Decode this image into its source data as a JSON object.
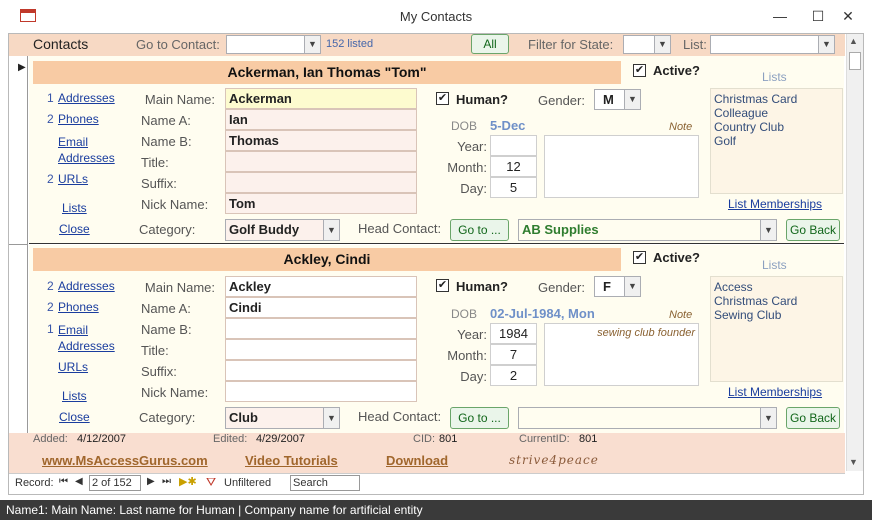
{
  "window": {
    "title": "My Contacts",
    "minimize": "—",
    "maximize": "☐",
    "close": "✕"
  },
  "header": {
    "title": "Contacts",
    "goto_label": "Go to Contact:",
    "listed": "152 listed",
    "all_button": "All",
    "filter_state_label": "Filter for State:",
    "list_label": "List:"
  },
  "records": [
    {
      "name_display": "Ackerman, Ian Thomas \"Tom\"",
      "active_label": "Active?",
      "active_checked": true,
      "side_links": [
        {
          "count": "1",
          "label": "Addresses"
        },
        {
          "count": "2",
          "label": "Phones"
        },
        {
          "count": "",
          "label": "Email Addresses"
        },
        {
          "count": "2",
          "label": "URLs"
        },
        {
          "count": "",
          "label": "Lists"
        },
        {
          "count": "",
          "label": "Close"
        }
      ],
      "fields": {
        "main_name_label": "Main Name:",
        "main_name": "Ackerman",
        "name_a_label": "Name A:",
        "name_a": "Ian",
        "name_b_label": "Name B:",
        "name_b": "Thomas",
        "title_label": "Title:",
        "title": "",
        "suffix_label": "Suffix:",
        "suffix": "",
        "nick_label": "Nick Name:",
        "nick": "Tom"
      },
      "human_label": "Human?",
      "human_checked": true,
      "gender_label": "Gender:",
      "gender": "M",
      "dob_label": "DOB",
      "dob": "5-Dec",
      "year_label": "Year:",
      "year": "",
      "month_label": "Month:",
      "month": "12",
      "day_label": "Day:",
      "day": "5",
      "note_label": "Note",
      "note": "",
      "lists_label": "Lists",
      "lists": [
        "Christmas Card",
        "Colleague",
        "Country Club",
        "Golf"
      ],
      "list_memberships": "List Memberships",
      "category_label": "Category:",
      "category": "Golf Buddy",
      "head_contact_label": "Head Contact:",
      "goto_btn": "Go to ...",
      "head_contact": "AB Supplies",
      "goback_btn": "Go Back"
    },
    {
      "name_display": "Ackley, Cindi",
      "active_label": "Active?",
      "active_checked": true,
      "side_links": [
        {
          "count": "2",
          "label": "Addresses"
        },
        {
          "count": "2",
          "label": "Phones"
        },
        {
          "count": "1",
          "label": "Email Addresses"
        },
        {
          "count": "",
          "label": "URLs"
        },
        {
          "count": "",
          "label": "Lists"
        },
        {
          "count": "",
          "label": "Close"
        }
      ],
      "fields": {
        "main_name_label": "Main Name:",
        "main_name": "Ackley",
        "name_a_label": "Name A:",
        "name_a": "Cindi",
        "name_b_label": "Name B:",
        "name_b": "",
        "title_label": "Title:",
        "title": "",
        "suffix_label": "Suffix:",
        "suffix": "",
        "nick_label": "Nick Name:",
        "nick": ""
      },
      "human_label": "Human?",
      "human_checked": true,
      "gender_label": "Gender:",
      "gender": "F",
      "dob_label": "DOB",
      "dob": "02-Jul-1984, Mon",
      "year_label": "Year:",
      "year": "1984",
      "month_label": "Month:",
      "month": "7",
      "day_label": "Day:",
      "day": "2",
      "note_label": "Note",
      "note": "sewing club founder",
      "lists_label": "Lists",
      "lists": [
        "Access",
        "Christmas Card",
        "Sewing Club"
      ],
      "list_memberships": "List Memberships",
      "category_label": "Category:",
      "category": "Club",
      "head_contact_label": "Head Contact:",
      "goto_btn": "Go to ...",
      "head_contact": "",
      "goback_btn": "Go Back"
    }
  ],
  "footer": {
    "added_label": "Added:",
    "added": "4/12/2007",
    "edited_label": "Edited:",
    "edited": "4/29/2007",
    "cid_label": "CID:",
    "cid": "801",
    "current_label": "CurrentID:",
    "current": "801",
    "site_link": "www.MsAccessGurus.com",
    "video_link": "Video Tutorials",
    "download_link": "Download",
    "logo_text": "strive4peace"
  },
  "nav": {
    "record_label": "Record:",
    "position": "2 of 152",
    "filter_status": "Unfiltered",
    "search_placeholder": "Search"
  },
  "status_bar": "Name1: Main Name: Last name for Human | Company name for artificial entity",
  "colors": {
    "accent_header": "#f7d9c4",
    "name_bar": "#f8cba4",
    "record_bg": "#fffdf0",
    "link": "#1a3d9e"
  }
}
